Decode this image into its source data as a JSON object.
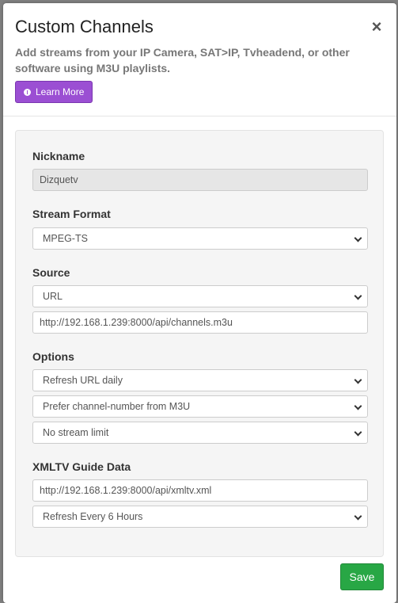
{
  "modal": {
    "title": "Custom Channels",
    "close_glyph": "×",
    "description": "Add streams from your IP Camera, SAT>IP, Tvheadend, or other software using M3U playlists.",
    "learn_more_label": "Learn More"
  },
  "form": {
    "nickname": {
      "label": "Nickname",
      "value": "Dizquetv"
    },
    "stream_format": {
      "label": "Stream Format",
      "selected": "MPEG-TS"
    },
    "source": {
      "label": "Source",
      "type_selected": "URL",
      "url_value": "http://192.168.1.239:8000/api/channels.m3u"
    },
    "options": {
      "label": "Options",
      "refresh_selected": "Refresh URL daily",
      "channel_number_selected": "Prefer channel-number from M3U",
      "stream_limit_selected": "No stream limit"
    },
    "xmltv": {
      "label": "XMLTV Guide Data",
      "url_value": "http://192.168.1.239:8000/api/xmltv.xml",
      "refresh_selected": "Refresh Every 6 Hours"
    }
  },
  "footer": {
    "save_label": "Save"
  },
  "colors": {
    "learn_more_bg": "#9b4fd3",
    "save_bg": "#28a745",
    "panel_bg": "#f5f5f5"
  },
  "icons": {
    "learn_more": "info-icon",
    "close": "close-icon",
    "select": "chevron-down-icon"
  }
}
